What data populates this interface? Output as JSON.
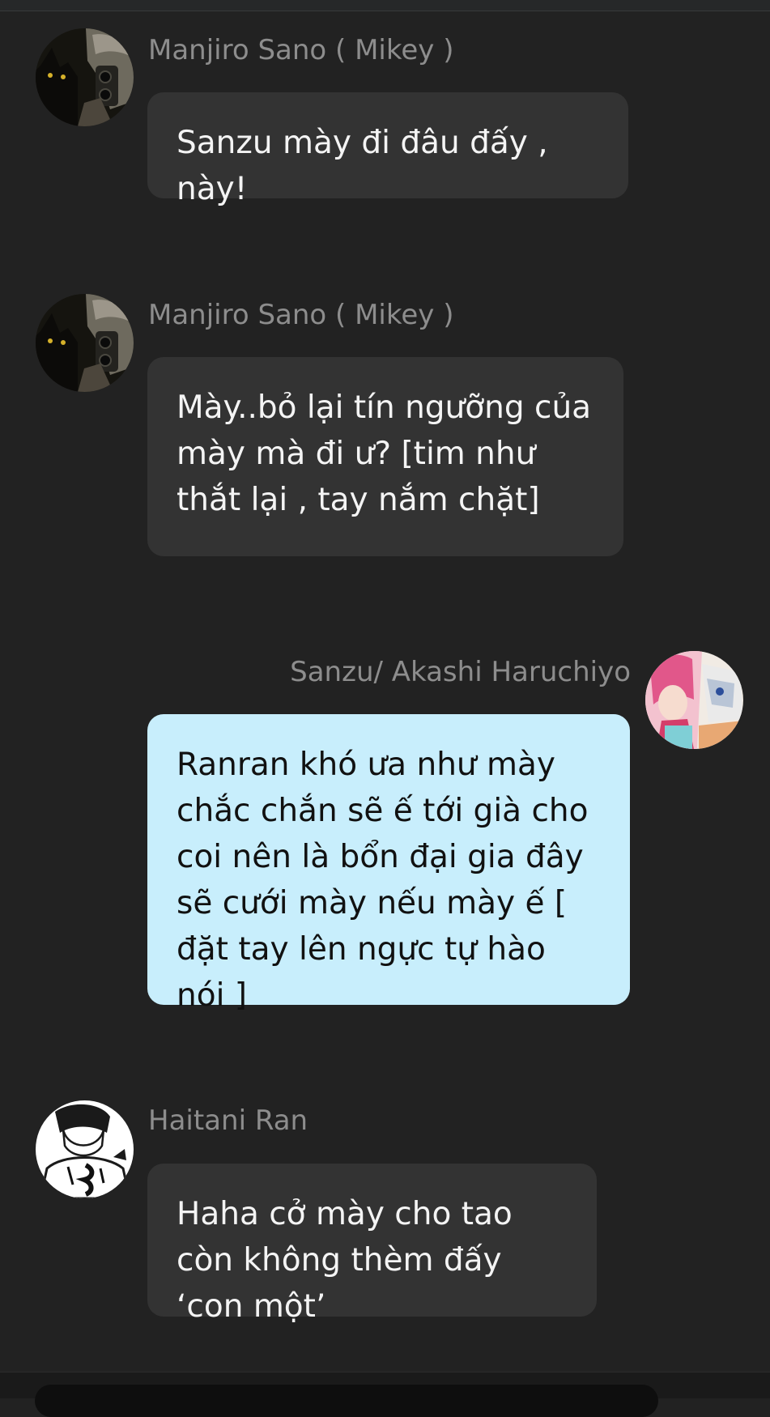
{
  "messages": [
    {
      "sender": "Manjiro Sano ( Mikey  )",
      "text": "Sanzu mày đi đâu đấy , này!",
      "avatar_icon": "mikey-avatar"
    },
    {
      "sender": "Manjiro Sano ( Mikey  )",
      "text": "Mày..bỏ lại tín ngưỡng của mày mà đi ư? [tim như thắt lại , tay nắm chặt]",
      "avatar_icon": "mikey-avatar"
    },
    {
      "sender": "Sanzu/ Akashi Haruchiyo",
      "text": "Ranran khó ưa như mày chắc chắn sẽ ế tới già cho coi nên là bổn đại gia đây sẽ cưới mày nếu mày ế [ đặt tay lên ngực tự hào nói ]",
      "avatar_icon": "sanzu-avatar"
    },
    {
      "sender": "Haitani Ran",
      "text": "Haha cở mày cho tao còn không thèm đấy ‘con một’",
      "avatar_icon": "ran-avatar"
    }
  ],
  "colors": {
    "background": "#222222",
    "bubble_other": "#333333",
    "bubble_mine": "#c8eefc",
    "sender_name": "#8d8d8d"
  }
}
